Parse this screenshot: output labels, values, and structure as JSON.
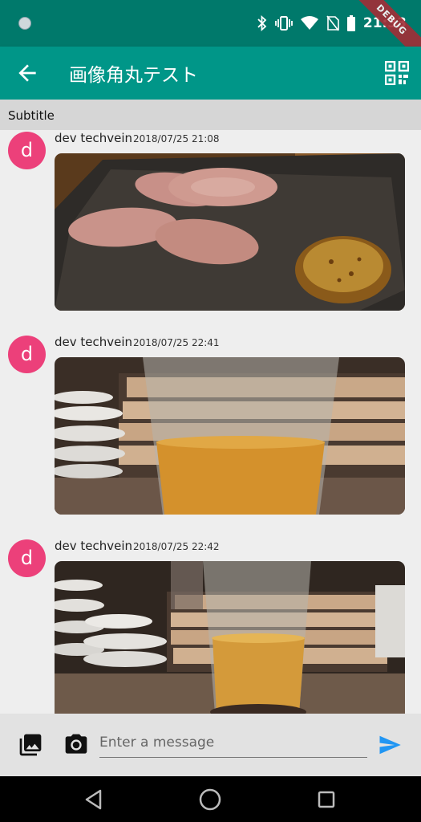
{
  "status_bar": {
    "time": "21:33",
    "debug_label": "DEBUG"
  },
  "app_bar": {
    "title": "画像角丸テスト",
    "back_icon": "arrow-back-icon",
    "action_icon": "qr-code-icon"
  },
  "subtitle": "Subtitle",
  "messages": [
    {
      "avatar_letter": "d",
      "name": "dev techvein",
      "time": "2018/07/25 21:08",
      "image": "sausage-with-mustard-photo"
    },
    {
      "avatar_letter": "d",
      "name": "dev techvein",
      "time": "2018/07/25 22:41",
      "image": "beer-glass-photo"
    },
    {
      "avatar_letter": "d",
      "name": "dev techvein",
      "time": "2018/07/25 22:42",
      "image": "beer-glass-photo"
    }
  ],
  "composer": {
    "placeholder": "Enter a message",
    "gallery_icon": "photo-library-icon",
    "camera_icon": "camera-icon",
    "send_icon": "send-icon"
  },
  "colors": {
    "status_bar": "#00796b",
    "app_bar": "#009688",
    "avatar": "#ec407a",
    "send": "#2196f3"
  }
}
